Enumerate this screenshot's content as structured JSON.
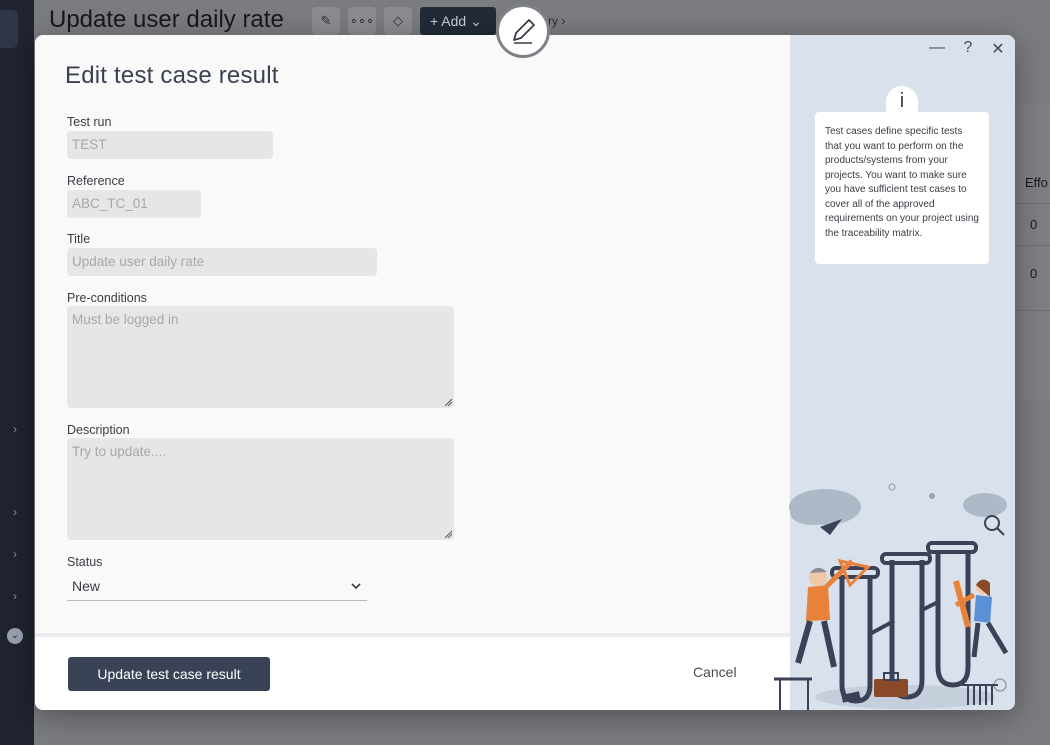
{
  "background": {
    "page_title": "Update user daily rate",
    "add_label": "+ Add",
    "breadcrumb_partial": "ry ›",
    "table_header": "Effo",
    "table_values": [
      "0",
      "0"
    ]
  },
  "modal": {
    "title": "Edit test case result",
    "fields": {
      "test_run": {
        "label": "Test run",
        "value": "TEST"
      },
      "reference": {
        "label": "Reference",
        "value": "ABC_TC_01"
      },
      "title": {
        "label": "Title",
        "value": "Update user daily rate"
      },
      "preconditions": {
        "label": "Pre-conditions",
        "value": "Must be logged in"
      },
      "description": {
        "label": "Description",
        "placeholder": "Try to update...."
      },
      "status": {
        "label": "Status",
        "value": "New"
      }
    },
    "buttons": {
      "submit": "Update test case result",
      "cancel": "Cancel"
    },
    "window_controls": {
      "minimize": "—",
      "help": "?",
      "close": "✕"
    },
    "info": {
      "icon": "i",
      "text": "Test cases define specific tests that you want to perform on the products/systems from your projects. You want to make sure you have sufficient test cases to cover all of the approved requirements on your project using the traceability matrix."
    }
  },
  "colors": {
    "primary_button": "#3a4356",
    "info_panel_bg": "#d9e1ec",
    "field_bg": "#e6e6e6",
    "illustration_orange": "#e8823a",
    "illustration_navy": "#3b4156"
  }
}
